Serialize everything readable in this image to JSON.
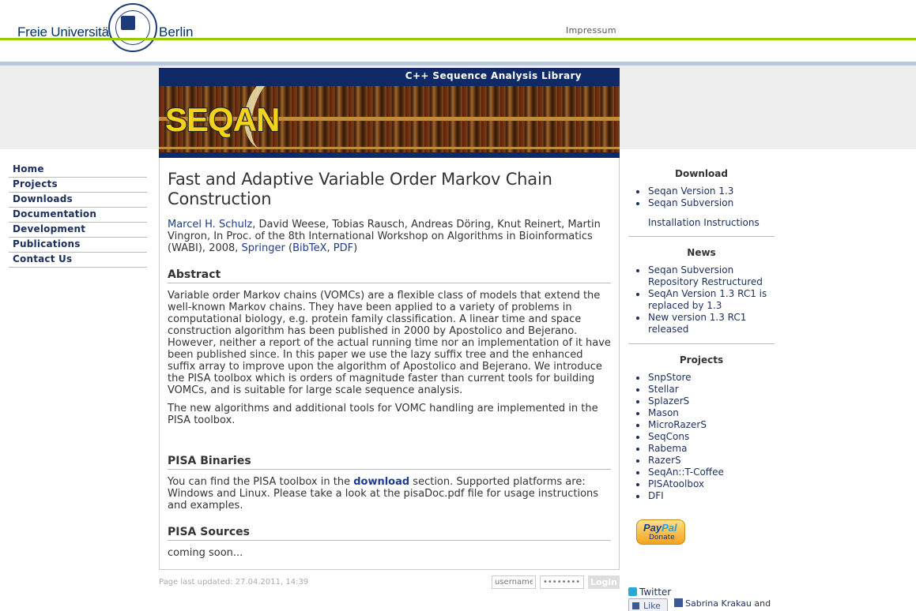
{
  "header": {
    "fu_left": "Freie Universität",
    "fu_right": "Berlin",
    "impressum": "Impressum"
  },
  "banner": {
    "title": "C++ Sequence Analysis Library",
    "logo_text": "SEQAN"
  },
  "nav": {
    "items": [
      {
        "label": "Home"
      },
      {
        "label": "Projects"
      },
      {
        "label": "Downloads"
      },
      {
        "label": "Documentation"
      },
      {
        "label": "Development"
      },
      {
        "label": "Publications"
      },
      {
        "label": "Contact Us"
      }
    ]
  },
  "main": {
    "title": "Fast and Adaptive Variable Order Markov Chain Construction",
    "authors": {
      "first_author": "Marcel H. Schulz",
      "rest": ", David Weese, Tobias Rausch, Andreas Döring, Knut Reinert, Martin Vingron, In Proc. of the 8th International Workshop on Algorithms in Bioinformatics (WABI), 2008, ",
      "springer": "Springer",
      "open_paren": " (",
      "bibtex": "BibTeX",
      "comma": ", ",
      "pdf": "PDF",
      "close_paren": ")"
    },
    "abstract_heading": "Abstract",
    "abstract_p1": "Variable order Markov chains (VOMCs) are a flexible class of models that extend the well-known Markov chains. They have been applied to a variety of problems in computational biology, e.g. protein family classification. A linear time and space construction algorithm has been published in 2000 by Apostolico and Bejerano. However, neither a report of the actual running time nor an implementation of it have been published since. In this paper we use the lazy suffix tree and the enhanced suffix array to improve upon the algorithm of Apostolico and Bejerano. We introduce the PISA toolbox which is orders of magnitude faster than current tools for building VOMCs, and is suitable for large scale sequence analysis.",
    "abstract_p2": "The new algorithms and additional tools for VOMC handling are implemented in the PISA toolbox.",
    "binaries_heading": "PISA Binaries",
    "binaries_pre": "You can find the PISA toolbox in the ",
    "binaries_link": "download",
    "binaries_post": " section. Supported platforms are: Windows and Linux. Please take a look at the pisaDoc.pdf file for usage instructions and examples.",
    "sources_heading": "PISA Sources",
    "sources_text": "coming soon..."
  },
  "footer": {
    "last_updated": "Page last updated: 27.04.2011, 14:39",
    "username_placeholder": "username",
    "password_placeholder": "••••••••",
    "login_label": "Login"
  },
  "right": {
    "download_title": "Download",
    "download_items": [
      {
        "label": "Seqan Version 1.3"
      },
      {
        "label": "Seqan Subversion"
      }
    ],
    "installation": "Installation Instructions",
    "news_title": "News",
    "news_items": [
      {
        "label": "Seqan Subversion Repository Restructured"
      },
      {
        "label": "SeqAn Version 1.3 RC1 is replaced by 1.3"
      },
      {
        "label": "New version 1.3 RC1 released"
      }
    ],
    "projects_title": "Projects",
    "project_items": [
      {
        "label": "SnpStore"
      },
      {
        "label": "Stellar"
      },
      {
        "label": "SplazerS"
      },
      {
        "label": "Mason"
      },
      {
        "label": "MicroRazerS"
      },
      {
        "label": "SeqCons"
      },
      {
        "label": "Rabema"
      },
      {
        "label": "RazerS"
      },
      {
        "label": "SeqAn::T-Coffee"
      },
      {
        "label": "PISAtoolbox"
      },
      {
        "label": "DFI"
      }
    ],
    "paypal_pay": "Pay",
    "paypal_pal": "Pal",
    "paypal_donate": "Donate",
    "twitter": "Twitter",
    "fb_like": "Like",
    "fb_text_name": "Sabrina Krakau",
    "fb_text_rest": " and"
  },
  "colors": {
    "green_line": "#99cc00",
    "nav_link": "#1b2f5e",
    "banner_blue": "#0f2a66"
  }
}
